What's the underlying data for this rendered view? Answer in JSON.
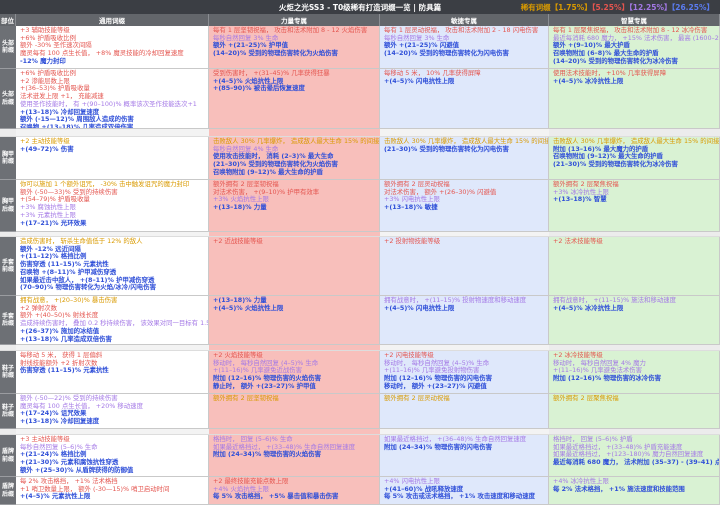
{
  "title": "火炬之光SS3 - T0级稀有打造词缀一览 | 防具篇",
  "legend": {
    "label": "稀有词缀",
    "tiers": [
      "【1.75%】",
      "【5.25%】",
      "【12.25%】",
      "【26.25%】"
    ],
    "colors": {
      "o": "#d99a00",
      "r": "#e4554f",
      "p": "#a479e6",
      "b": "#2f4fd8"
    }
  },
  "headers": [
    "部位",
    "通用词缀",
    "力量专属",
    "敏捷专属",
    "智慧专属"
  ],
  "rows": [
    {
      "label": [
        "头部",
        "前缀"
      ],
      "cells": [
        [
          [
            "r",
            "+3 辅助技能等级"
          ],
          [
            "r",
            "+6% 护盾吸收比例"
          ],
          [
            "r",
            "额外 -30% 圣作速次间隔"
          ],
          [
            "r",
            "魔灵每有 100 点生长值， +8% 魔灵技能的冷却回复速度"
          ],
          [
            "b",
            "-12% 魔力封印"
          ]
        ],
        [
          [
            "r",
            "每有 1 层坚韧祝福， 攻击和法术附加 8 - 12 火焰伤害"
          ],
          [
            "p",
            "每秒自然回复 3% 生命"
          ],
          [
            "b",
            "额外 +(21–25)% 护甲值"
          ],
          [
            "b",
            "(14–20)% 受到的物理伤害转化为火焰伤害"
          ]
        ],
        [
          [
            "r",
            "每有 1 层灵动祝福， 攻击和法术附加 2 - 18 闪电伤害"
          ],
          [
            "p",
            "每秒自然回复 3% 生命"
          ],
          [
            "b",
            "额外 +(21–25)% 闪避值"
          ],
          [
            "b",
            "(14–20)% 受到的物理伤害转化为闪电伤害"
          ]
        ],
        [
          [
            "r",
            "每有 1 层聚焦祝福， 攻击和法术附加 8 - 12 冰冷伤害"
          ],
          [
            "p",
            "最近每消耗 680 魔力， +15% 法术伤害， 最高 (1600–2200)%"
          ],
          [
            "b",
            "额外 +(9–10)% 最大护盾"
          ],
          [
            "b",
            "召唤物附加 (6–8)% 最大生命的护盾"
          ],
          [
            "b",
            "(14–20)% 受到的物理伤害转化为冰冷伤害"
          ]
        ]
      ]
    },
    {
      "label": [
        "头部",
        "后缀"
      ],
      "cells": [
        [
          [
            "r",
            "+6% 护盾吸收比例"
          ],
          [
            "r",
            "+2 渗能层数上限"
          ],
          [
            "r",
            "+(36–53)% 护盾吸收量"
          ],
          [
            "r",
            "法术迸发上限 +1， 充能减速"
          ],
          [
            "p",
            "使用圣作技能时， 有 +(90–100)% 概率该次圣作技能迭次+1"
          ],
          [
            "b",
            "+(13–18)% 冷却回复速度"
          ],
          [
            "b",
            "额外 (-15—12)% 周围敌人造成的伤害"
          ],
          [
            "b",
            "召唤物 +(13–18)% 几率造成双倍伤害"
          ]
        ],
        [
          [
            "r",
            "受到伤害时， +(31–45)% 几率获得狂暴"
          ],
          [
            "b",
            "+(4–5)% 火焰抗性上限"
          ],
          [
            "b",
            "+(85–90)% 被击晕后恢复速度"
          ]
        ],
        [
          [
            "r",
            "每移动 5 米， 10% 几率获得屏障"
          ],
          [
            "b",
            "+(4–5)% 闪电抗性上限"
          ]
        ],
        [
          [
            "r",
            "使用法术技能时， +10% 几率获得屏障"
          ],
          [
            "b",
            "+(4–5)% 冰冷抗性上限"
          ]
        ]
      ]
    },
    {
      "label": [
        "胸甲",
        "前缀"
      ],
      "cells": [
        [
          [
            "o",
            "+2 主动技能等级"
          ],
          [
            "b",
            "+(49–72)% 伤害"
          ]
        ],
        [
          [
            "o",
            "击败敌人 30% 几率爆炸， 造成敌人最大生命 15% 的间接火焰伤害"
          ],
          [
            "p",
            "每秒自然回复 4% 生命"
          ],
          [
            "b",
            "使用攻击技能时， 消耗 (2–3)% 最大生命"
          ],
          [
            "b",
            "(21–30)% 受到的物理伤害转化为火焰伤害"
          ],
          [
            "b",
            "召唤物附加 (9–12)% 最大生命的护盾"
          ]
        ],
        [
          [
            "o",
            "击败敌人 30% 几率爆炸， 造成敌人最大生命 15% 的间接闪电伤害"
          ],
          [
            "b",
            "(21–30)% 受到的物理伤害转化为闪电伤害"
          ]
        ],
        [
          [
            "o",
            "击败敌人 30% 几率爆炸， 造成敌人最大生命 15% 的间接冰冷伤害"
          ],
          [
            "b",
            "附加 (13–16)% 最大魔力的护盾"
          ],
          [
            "b",
            "召唤物附加 (9–12)% 最大生命的护盾"
          ],
          [
            "b",
            "(21–30)% 受到的物理伤害转化为冰冷伤害"
          ]
        ]
      ]
    },
    {
      "label": [
        "胸甲",
        "后缀"
      ],
      "cells": [
        [
          [
            "o",
            "你可以施加 1 个额外诅咒， -30% 击中触发诅咒的魔力封印"
          ],
          [
            "r",
            "额外 (-50—33)% 受到的持续伤害"
          ],
          [
            "r",
            "+(54–79)% 护盾吸收量"
          ],
          [
            "p",
            "+3% 腐蚀抗性上限"
          ],
          [
            "p",
            "+3% 元素抗性上限"
          ],
          [
            "b",
            "+(17–21)% 光环效果"
          ]
        ],
        [
          [
            "r",
            "额外拥有 2 层坚韧祝福"
          ],
          [
            "r",
            "对法术伤害， +(9–10)% 护甲有效率"
          ],
          [
            "p",
            "+3% 火焰抗性上限"
          ],
          [
            "b",
            "+(13–18)% 力量"
          ]
        ],
        [
          [
            "r",
            "额外拥有 2 层灵动祝福"
          ],
          [
            "r",
            "对法术伤害， 额外 +(26–30)% 闪避值"
          ],
          [
            "p",
            "+3% 闪电抗性上限"
          ],
          [
            "b",
            "+(13–18)% 敏捷"
          ]
        ],
        [
          [
            "r",
            "额外拥有 2 层聚焦祝福"
          ],
          [
            "p",
            "+3% 冰冷抗性上限"
          ],
          [
            "b",
            "+(13–18)% 智慧"
          ]
        ]
      ]
    },
    {
      "label": [
        "手套",
        "前缀"
      ],
      "cells": [
        [
          [
            "o",
            "造成伤害时， 斩杀生命值低于 12% 的敌人"
          ],
          [
            "b",
            "额外 -12% 远近间隔"
          ],
          [
            "b",
            "+(11–12)% 格挡比例"
          ],
          [
            "b",
            "伤害穿透 (11–15)% 元素抗性"
          ],
          [
            "b",
            "召唤物 +(8–11)% 护甲减伤穿透"
          ],
          [
            "b",
            "如果最近击中敌人， +(8–11)% 护甲减伤穿透"
          ],
          [
            "b",
            "(70–90)% 物理伤害转化为火焰/冰冷/闪电伤害"
          ]
        ],
        [
          [
            "r",
            "+2 近战技能等级"
          ]
        ],
        [
          [
            "r",
            "+2 投射物技能等级"
          ]
        ],
        [
          [
            "r",
            "+2 法术技能等级"
          ]
        ]
      ]
    },
    {
      "label": [
        "手套",
        "后缀"
      ],
      "cells": [
        [
          [
            "o",
            "拥有战意， +(20–30)% 暴击伤害"
          ],
          [
            "r",
            "+2 弹射次数"
          ],
          [
            "r",
            "额外 +(40–50)% 射线长度"
          ],
          [
            "p",
            "造成持续伤害时， 叠加 0.2 秒持续伤害， 该效果对同一目标有 1.5 秒冷却时间"
          ],
          [
            "b",
            "+(26–37)% 施加的冰结值"
          ],
          [
            "b",
            "+(13–18)% 几率造成双倍伤害"
          ]
        ],
        [
          [
            "b",
            "+(13–18)% 力量"
          ],
          [
            "b",
            "+(4–5)% 火焰抗性上限"
          ]
        ],
        [
          [
            "p",
            "拥有战意时， +(11–15)% 投射物速度和移动速度"
          ],
          [
            "b",
            "+(4–5)% 闪电抗性上限"
          ]
        ],
        [
          [
            "p",
            "拥有战意时， +(11–15)% 施法和移动速度"
          ],
          [
            "b",
            "+(4–5)% 冰冷抗性上限"
          ]
        ]
      ]
    },
    {
      "label": [
        "鞋子",
        "前缀"
      ],
      "cells": [
        [
          [
            "r",
            "每移动 5 米， 获得 1 层偏斜"
          ],
          [
            "r",
            "射线技能额外 +2 折射次数"
          ],
          [
            "b",
            "伤害穿透 (11–15)% 元素抗性"
          ]
        ],
        [
          [
            "r",
            "+2 火焰技能等级"
          ],
          [
            "p",
            "移动时， 每秒自然回复 (4–5)% 生命"
          ],
          [
            "p",
            "+(11–16)% 几率避免近战伤害"
          ],
          [
            "b",
            "附加 (12–16)% 物理伤害的火焰伤害"
          ],
          [
            "b",
            "静止时， 额外 +(23–27)% 护甲值"
          ]
        ],
        [
          [
            "r",
            "+2 闪电技能等级"
          ],
          [
            "p",
            "移动时， 每秒自然回复 (4–5)% 生命"
          ],
          [
            "p",
            "+(11–16)% 几率避免投射物伤害"
          ],
          [
            "b",
            "附加 (12–16)% 物理伤害的闪电伤害"
          ],
          [
            "b",
            "移动时， 额外 +(23–27)% 闪避值"
          ]
        ],
        [
          [
            "r",
            "+2 冰冷技能等级"
          ],
          [
            "p",
            "移动时， 每秒自然回复 4% 魔力"
          ],
          [
            "p",
            "+(11–16)% 几率避免法术伤害"
          ],
          [
            "b",
            "附加 (12–16)% 物理伤害的冰冷伤害"
          ]
        ]
      ]
    },
    {
      "label": [
        "鞋子",
        "后缀"
      ],
      "cells": [
        [
          [
            "p",
            "额外 (-50—22)% 受到的持续伤害"
          ],
          [
            "p",
            "魔灵每有 100 点生长值， +20% 移动速度"
          ],
          [
            "b",
            "+(17–24)% 诅咒效果"
          ],
          [
            "b",
            "+(13–18)% 冷却回复速度"
          ]
        ],
        [
          [
            "o",
            "额外拥有 2 层坚韧祝福"
          ]
        ],
        [
          [
            "o",
            "额外拥有 2 层灵动祝福"
          ]
        ],
        [
          [
            "o",
            "额外拥有 2 层聚焦祝福"
          ]
        ]
      ]
    },
    {
      "label": [
        "盾牌",
        "前缀"
      ],
      "cells": [
        [
          [
            "r",
            "+3 主动技能等级"
          ],
          [
            "p",
            "每秒自然回复 (5–6)% 生命"
          ],
          [
            "b",
            "+(21–24)% 格挡比例"
          ],
          [
            "b",
            "+(21–30)% 元素和腐蚀抗性穿透"
          ],
          [
            "b",
            "额外 +(25–30)% 从盾牌获得的防御值"
          ]
        ],
        [
          [
            "p",
            "格挡时， 回复 (5–6)% 生命"
          ],
          [
            "p",
            "如果最近格挡过， +(33–48)% 生命自然回复速度"
          ],
          [
            "b",
            "附加 (24–34)% 物理伤害的火焰伤害"
          ]
        ],
        [
          [
            "p",
            "如果最近格挡过， +(36–48)% 生命自然回复速度"
          ],
          [
            "b",
            "附加 (24–34)% 物理伤害的闪电伤害"
          ]
        ],
        [
          [
            "p",
            "格挡时， 回复 (5–6)% 护盾"
          ],
          [
            "p",
            "如果最近格挡过， +(33–48)% 护盾充能速度"
          ],
          [
            "p",
            "如果最近格挡过， +(123–180)% 魔力自然回复速度"
          ],
          [
            "b",
            "最近每消耗 680 魔力， 法术附加 (35–37) - (39–41) 点冰冷伤害"
          ]
        ]
      ]
    },
    {
      "label": [
        "盾牌",
        "后缀"
      ],
      "cells": [
        [
          [
            "r",
            "每 2% 攻击格挡， +1% 法术格挡"
          ],
          [
            "r",
            "+1 哨卫数量上限， 额外 (-30—15)% 哨卫启动时间"
          ],
          [
            "b",
            "+(4–5)% 元素抗性上限"
          ]
        ],
        [
          [
            "r",
            "+2 最终技能充能点数上限"
          ],
          [
            "p",
            "+4% 火焰抗性上限"
          ],
          [
            "b",
            "每 5% 攻击格挡， +5% 暴击值和暴击伤害"
          ]
        ],
        [
          [
            "p",
            "+4% 闪电抗性上限"
          ],
          [
            "b",
            "+(41–60)% 战吼释放速度"
          ],
          [
            "b",
            "每 5% 攻击或法术格挡， +1% 攻击速度和移动速度"
          ]
        ],
        [
          [
            "p",
            "+4% 冰冷抗性上限"
          ],
          [
            "b",
            "每 2% 法术格挡， +1% 施法速度和技能范围"
          ]
        ]
      ]
    }
  ]
}
